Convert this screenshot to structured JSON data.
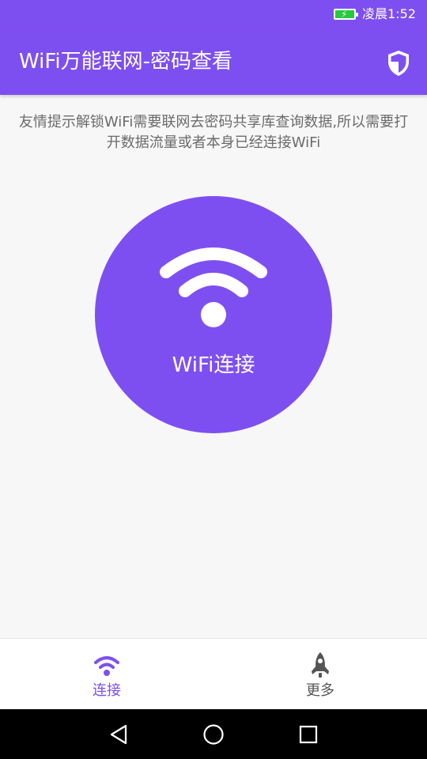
{
  "status_bar": {
    "time": "凌晨1:52",
    "battery_color": "#27c93f"
  },
  "app_bar": {
    "title": "WiFi万能联网-密码查看",
    "action_icon": "shield-icon"
  },
  "tip": {
    "text": "友情提示解锁WiFi需要联网去密码共享库查询数据,所以需要打开数据流量或者本身已经连接WiFi"
  },
  "connect_button": {
    "label": "WiFi连接",
    "icon": "wifi-icon"
  },
  "bottom_nav": {
    "items": [
      {
        "label": "连接",
        "icon": "wifi-icon",
        "active": true
      },
      {
        "label": "更多",
        "icon": "rocket-icon",
        "active": false
      }
    ]
  },
  "system_nav": {
    "buttons": [
      "back-icon",
      "home-icon",
      "recents-icon"
    ]
  },
  "colors": {
    "primary": "#7e4ff0",
    "background": "#f7f7f7",
    "tip_text": "#6b6b6b"
  }
}
